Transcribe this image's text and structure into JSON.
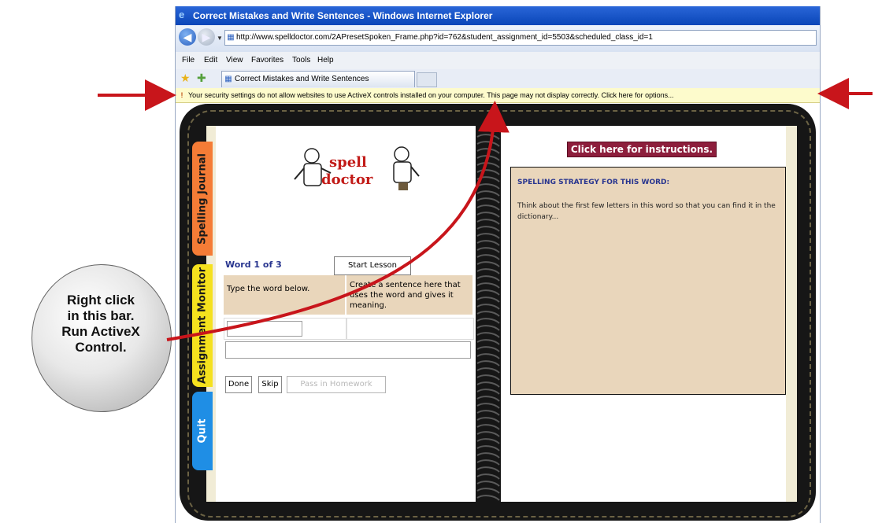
{
  "window": {
    "title": "Correct Mistakes and Write Sentences - Windows Internet Explorer",
    "address": "http://www.spelldoctor.com/2APresetSpoken_Frame.php?id=762&student_assignment_id=5503&scheduled_class_id=1",
    "menu": [
      "File",
      "Edit",
      "View",
      "Favorites",
      "Tools",
      "Help"
    ],
    "tab_label": "Correct Mistakes and Write Sentences",
    "info_bar": "Your security settings do not allow websites to use ActiveX controls installed on your computer. This page may not display correctly. Click here for options..."
  },
  "side_tabs": [
    "Spelling Journal",
    "Assignment Monitor",
    "Quit"
  ],
  "lesson": {
    "word_count": "Word 1 of 3",
    "start_button": "Start Lesson",
    "col_word": "Type the word below.",
    "col_sentence": "Create a sentence here that uses the word and gives it meaning.",
    "done_button": "Done",
    "skip_button": "Skip",
    "homework_button": "Pass in Homework"
  },
  "logo": {
    "line1": "spell",
    "line2": "doctor"
  },
  "instructions_button": "Click here for instructions.",
  "strategy": {
    "heading": "SPELLING STRATEGY FOR THIS WORD:",
    "text": "Think about the first few letters in this word so that you can find it in the dictionary..."
  },
  "callout": [
    "Right click",
    "in this bar.",
    "Run ActiveX",
    "Control."
  ],
  "colors": {
    "arrow": "#c8151b",
    "instructions_bg": "#8d1e3c",
    "tab_journal": "#f57c36",
    "tab_monitor": "#f5e11e",
    "tab_quit": "#1f8ee5",
    "panel_bg": "#e9d6bb"
  }
}
